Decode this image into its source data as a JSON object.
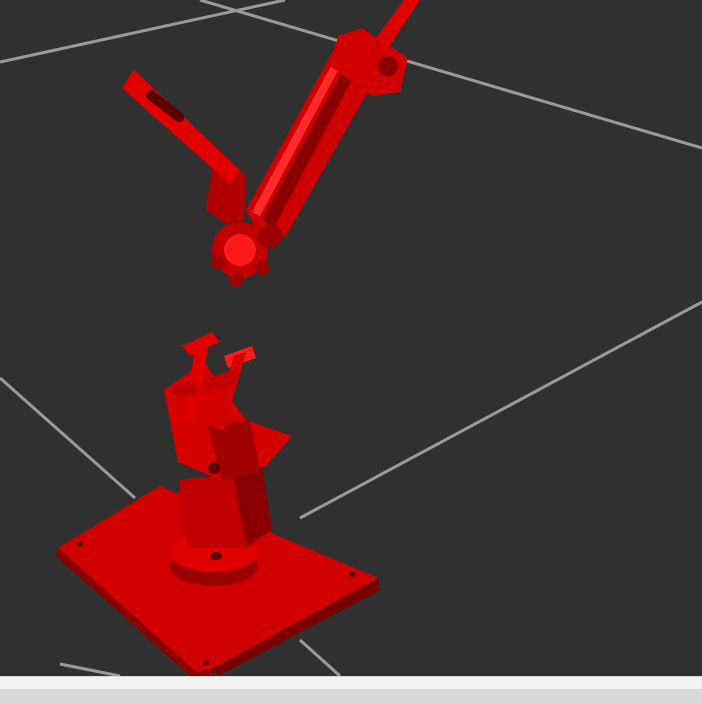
{
  "viewport": {
    "background_color": "#303030",
    "grid_color": "#a0a0a0",
    "model_color": "#e00000",
    "model_shadow_color": "#7a0000",
    "model_highlight_color": "#ff2020"
  },
  "status_strip": {
    "color": "#f2f2f2"
  }
}
